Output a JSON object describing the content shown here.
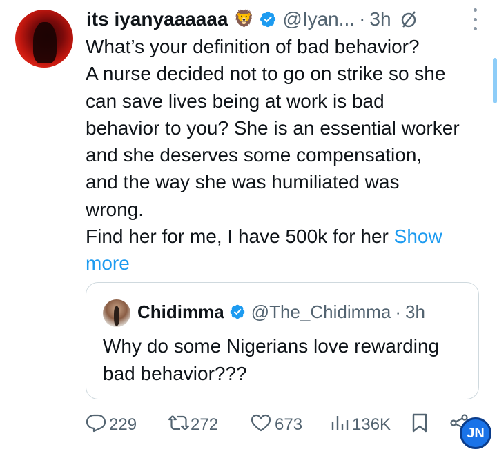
{
  "tweet": {
    "display_name": "its iyanyaaaaaa",
    "name_emoji": "🦁",
    "handle": "@Iyan...",
    "separator": "·",
    "time": "3h",
    "body_lines": [
      "What’s your definition of bad behavior?",
      "A nurse decided not to go on strike so she",
      "can save lives being at work is bad",
      "behavior to you? She is an essential worker",
      "and she deserves some compensation,",
      "and the way she was humiliated was",
      "wrong.",
      "Find her for me, I have 500k for her "
    ],
    "show_more_1": "Show",
    "show_more_2": "more"
  },
  "quoted": {
    "display_name": "Chidimma",
    "handle": "@The_Chidimma",
    "separator": "·",
    "time": "3h",
    "body_lines": [
      "Why do some Nigerians love rewarding",
      "bad behavior???"
    ]
  },
  "actions": {
    "replies": "229",
    "retweets": "272",
    "likes": "673",
    "views": "136K"
  },
  "watermark": "JN",
  "colors": {
    "accent": "#1d9bf0",
    "secondary_text": "#536471",
    "primary_text": "#0f1419",
    "border": "#cfd9de"
  },
  "icons": [
    "lion-emoji",
    "verified-icon",
    "null-sign-icon",
    "more-options-icon",
    "reply-icon",
    "retweet-icon",
    "like-icon",
    "views-icon",
    "bookmark-icon",
    "share-icon"
  ]
}
